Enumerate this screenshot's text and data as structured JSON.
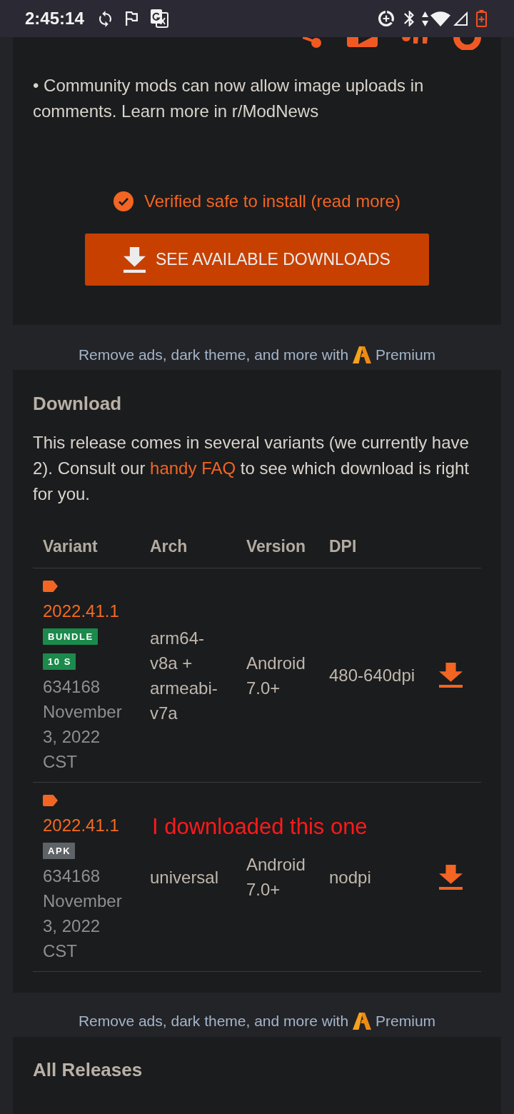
{
  "status_bar": {
    "time": "2:45:14"
  },
  "announcement": {
    "text": "• Community mods can now allow image uploads in comments. Learn more in r/ModNews"
  },
  "verified": {
    "text": "Verified safe to install (read more)"
  },
  "downloads_button": {
    "label": "SEE AVAILABLE DOWNLOADS"
  },
  "promos": [
    {
      "text": "Remove ads, dark theme, and more with",
      "brand": "Premium"
    },
    {
      "text": "Remove ads, dark theme, and more with",
      "brand": "Premium"
    }
  ],
  "download_section": {
    "title": "Download",
    "intro": {
      "before": "This release comes in several variants (we currently have 2). Consult our ",
      "link": "handy FAQ",
      "after": " to see which download is right for you."
    },
    "table": {
      "columns": [
        "Variant",
        "Arch",
        "Version",
        "DPI"
      ],
      "rows": [
        {
          "version": "2022.41.1",
          "badges": [
            {
              "text": "BUNDLE",
              "color": "#1b8a4b"
            },
            {
              "text": "10 S",
              "color": "#1b8a4b"
            }
          ],
          "build": "634168",
          "date": "November 3, 2022 CST",
          "arch": "arm64-v8a + armeabi-v7a",
          "min_android": "Android 7.0+",
          "dpi": "480-640dpi"
        },
        {
          "version": "2022.41.1",
          "badges": [
            {
              "text": "APK",
              "color": "#5e6367"
            }
          ],
          "build": "634168",
          "date": "November 3, 2022 CST",
          "arch": "universal",
          "min_android": "Android 7.0+",
          "dpi": "nodpi",
          "note": "I downloaded this one"
        }
      ]
    }
  },
  "all_releases": {
    "title": "All Releases"
  }
}
